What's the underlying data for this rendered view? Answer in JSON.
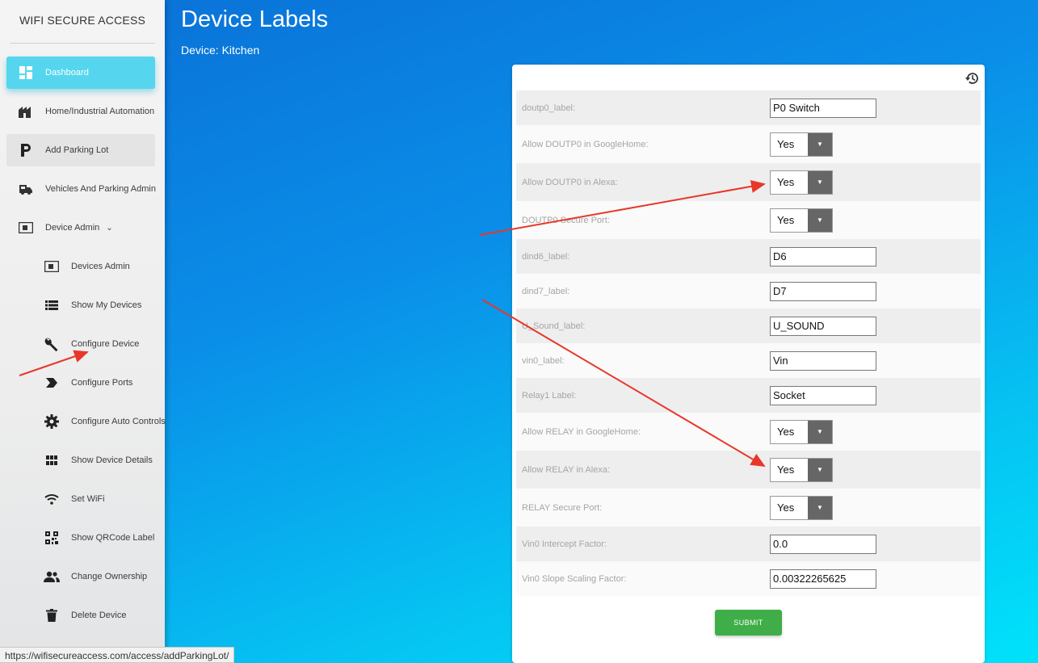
{
  "sidebar": {
    "brand": "WIFI SECURE ACCESS",
    "items": [
      {
        "label": "Dashboard",
        "icon": "dashboard-icon"
      },
      {
        "label": "Home/Industrial Automation",
        "icon": "factory-icon"
      },
      {
        "label": "Add Parking Lot",
        "icon": "parking-icon"
      },
      {
        "label": "Vehicles And Parking Admin",
        "icon": "vehicle-icon"
      },
      {
        "label": "Device Admin",
        "icon": "device-icon"
      },
      {
        "label": "Devices Admin",
        "icon": "device-icon"
      },
      {
        "label": "Show My Devices",
        "icon": "list-icon"
      },
      {
        "label": "Configure Device",
        "icon": "wrench-icon"
      },
      {
        "label": "Configure Ports",
        "icon": "label-arrow-icon"
      },
      {
        "label": "Configure Auto Controls",
        "icon": "gear-icon"
      },
      {
        "label": "Show Device Details",
        "icon": "grid-icon"
      },
      {
        "label": "Set WiFi",
        "icon": "wifi-icon"
      },
      {
        "label": "Show QRCode Label",
        "icon": "qrcode-icon"
      },
      {
        "label": "Change Ownership",
        "icon": "people-icon"
      },
      {
        "label": "Delete Device",
        "icon": "trash-icon"
      }
    ],
    "device_admin_chevron": "⌄"
  },
  "status_url": "https://wifisecureaccess.com/access/addParkingLot/",
  "header": {
    "title": "Device Labels",
    "subtitle": "Device: Kitchen"
  },
  "form": {
    "fields": [
      {
        "label": "doutp0_label:",
        "type": "text",
        "value": "P0 Switch"
      },
      {
        "label": "Allow DOUTP0 in GoogleHome:",
        "type": "select",
        "value": "Yes"
      },
      {
        "label": "Allow DOUTP0 in Alexa:",
        "type": "select",
        "value": "Yes"
      },
      {
        "label": "DOUTP0 Secure Port:",
        "type": "select",
        "value": "Yes"
      },
      {
        "label": "dind6_label:",
        "type": "text",
        "value": "D6"
      },
      {
        "label": "dind7_label:",
        "type": "text",
        "value": "D7"
      },
      {
        "label": "U_Sound_label:",
        "type": "text",
        "value": "U_SOUND"
      },
      {
        "label": "vin0_label:",
        "type": "text",
        "value": "Vin"
      },
      {
        "label": "Relay1 Label:",
        "type": "text",
        "value": "Socket"
      },
      {
        "label": "Allow RELAY in GoogleHome:",
        "type": "select",
        "value": "Yes"
      },
      {
        "label": "Allow RELAY in Alexa:",
        "type": "select",
        "value": "Yes"
      },
      {
        "label": "RELAY Secure Port:",
        "type": "select",
        "value": "Yes"
      },
      {
        "label": "Vin0 Intercept Factor:",
        "type": "text",
        "value": "0.0"
      },
      {
        "label": "Vin0 Slope Scaling Factor:",
        "type": "text",
        "value": "0.00322265625"
      }
    ],
    "submit_label": "SUBMIT",
    "dropdown_arrow": "▼",
    "reset_icon": "history-icon"
  },
  "colors": {
    "active_nav": "#55d6ee",
    "submit": "#3fae49",
    "annotation_arrow": "#e8372a"
  }
}
